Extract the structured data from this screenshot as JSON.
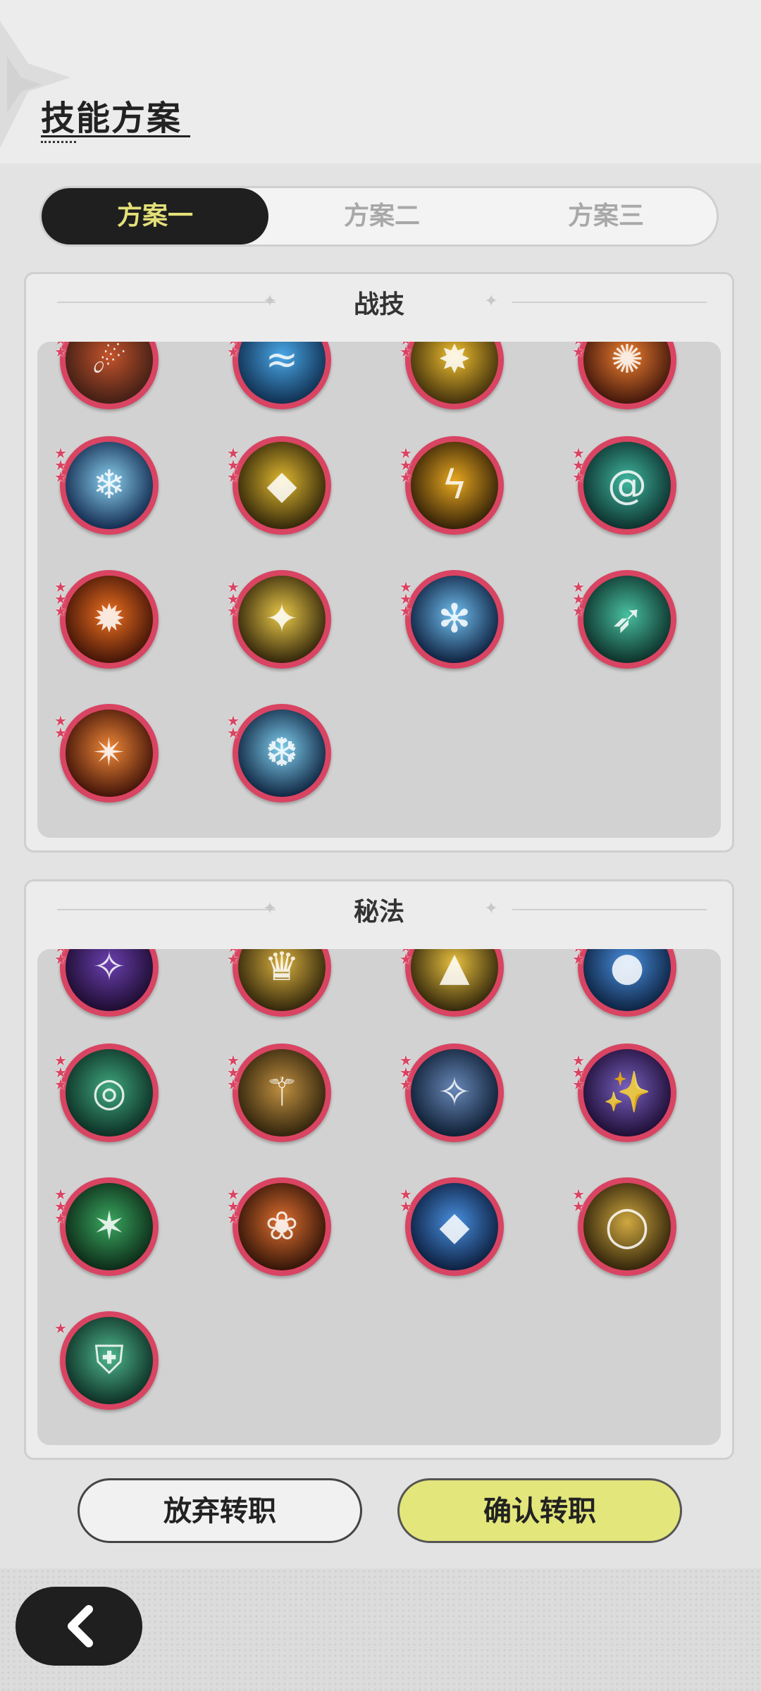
{
  "header": {
    "title": "技能方案"
  },
  "tabs": [
    {
      "label": "方案一",
      "active": true
    },
    {
      "label": "方案二",
      "active": false
    },
    {
      "label": "方案三",
      "active": false
    }
  ],
  "battle_skills": {
    "title": "战技",
    "icons": [
      {
        "name": "meteor-skill-icon",
        "colors": [
          "#3a1c14",
          "#c4542c"
        ],
        "glyph": "☄",
        "stars": 3
      },
      {
        "name": "water-splash-skill-icon",
        "colors": [
          "#0d2a4a",
          "#4aa8e8"
        ],
        "glyph": "≈",
        "stars": 3
      },
      {
        "name": "lightning-burst-skill-icon",
        "colors": [
          "#3a2a0a",
          "#f0c030"
        ],
        "glyph": "✸",
        "stars": 3
      },
      {
        "name": "fire-burst-skill-icon",
        "colors": [
          "#3a120a",
          "#f08030"
        ],
        "glyph": "✺",
        "stars": 3
      },
      {
        "name": "ice-shatter-skill-icon",
        "colors": [
          "#0d2448",
          "#8ad0f0"
        ],
        "glyph": "❄",
        "stars": 3
      },
      {
        "name": "golden-crystal-skill-icon",
        "colors": [
          "#2a2008",
          "#e0b830"
        ],
        "glyph": "◆",
        "stars": 3
      },
      {
        "name": "thunder-strike-skill-icon",
        "colors": [
          "#2a1a06",
          "#e8a820"
        ],
        "glyph": "ϟ",
        "stars": 3
      },
      {
        "name": "wind-vortex-skill-icon",
        "colors": [
          "#0a2a28",
          "#40b8a0"
        ],
        "glyph": "@",
        "stars": 3
      },
      {
        "name": "flame-skill-icon",
        "colors": [
          "#3a1006",
          "#f07020"
        ],
        "glyph": "✹",
        "stars": 3
      },
      {
        "name": "starlight-skill-icon",
        "colors": [
          "#2a1e08",
          "#e8c848"
        ],
        "glyph": "✦",
        "stars": 3
      },
      {
        "name": "frost-flower-skill-icon",
        "colors": [
          "#0a1a38",
          "#70c0f0"
        ],
        "glyph": "✻",
        "stars": 3
      },
      {
        "name": "wind-blade-skill-icon",
        "colors": [
          "#0a2a24",
          "#48c0a0"
        ],
        "glyph": "➶",
        "stars": 3
      },
      {
        "name": "fire-spiral-skill-icon",
        "colors": [
          "#3a0e06",
          "#f08838"
        ],
        "glyph": "✴",
        "stars": 2
      },
      {
        "name": "ice-crystal-skill-icon",
        "colors": [
          "#0a1e3a",
          "#80d0f0"
        ],
        "glyph": "❆",
        "stars": 2
      }
    ]
  },
  "secret_arts": {
    "title": "秘法",
    "icons": [
      {
        "name": "arcane-potion-art-icon",
        "colors": [
          "#1a0a2a",
          "#6a40b0"
        ],
        "glyph": "✧",
        "stars": 3
      },
      {
        "name": "golden-lantern-art-icon",
        "colors": [
          "#2a2008",
          "#d8b040"
        ],
        "glyph": "♛",
        "stars": 3
      },
      {
        "name": "golden-wings-art-icon",
        "colors": [
          "#2a2008",
          "#e8c040"
        ],
        "glyph": "▲",
        "stars": 3
      },
      {
        "name": "water-drop-art-icon",
        "colors": [
          "#0a1e3a",
          "#4a90e0"
        ],
        "glyph": "●",
        "stars": 3
      },
      {
        "name": "wind-chain-art-icon",
        "colors": [
          "#0a2a20",
          "#40a880"
        ],
        "glyph": "◎",
        "stars": 3
      },
      {
        "name": "golden-staff-art-icon",
        "colors": [
          "#2a1e0a",
          "#c09040"
        ],
        "glyph": "⚚",
        "stars": 3
      },
      {
        "name": "crystal-orb-art-icon",
        "colors": [
          "#0a1a2e",
          "#6888b8"
        ],
        "glyph": "✧",
        "stars": 3
      },
      {
        "name": "magic-portal-art-icon",
        "colors": [
          "#1a0a2e",
          "#7860c0"
        ],
        "glyph": "✨",
        "stars": 3
      },
      {
        "name": "green-claw-art-icon",
        "colors": [
          "#0a2414",
          "#3aa860"
        ],
        "glyph": "✶",
        "stars": 3
      },
      {
        "name": "fire-spirit-art-icon",
        "colors": [
          "#2a1006",
          "#e07030"
        ],
        "glyph": "❀",
        "stars": 3
      },
      {
        "name": "blue-gem-art-icon",
        "colors": [
          "#0a1a38",
          "#4890e0"
        ],
        "glyph": "◆",
        "stars": 2
      },
      {
        "name": "golden-ring-art-icon",
        "colors": [
          "#2a1e08",
          "#d0a840"
        ],
        "glyph": "◯",
        "stars": 2
      },
      {
        "name": "green-shield-art-icon",
        "colors": [
          "#0a2a20",
          "#50b890"
        ],
        "glyph": "⛨",
        "stars": 1
      }
    ]
  },
  "buttons": {
    "abandon": "放弃转职",
    "confirm": "确认转职"
  }
}
